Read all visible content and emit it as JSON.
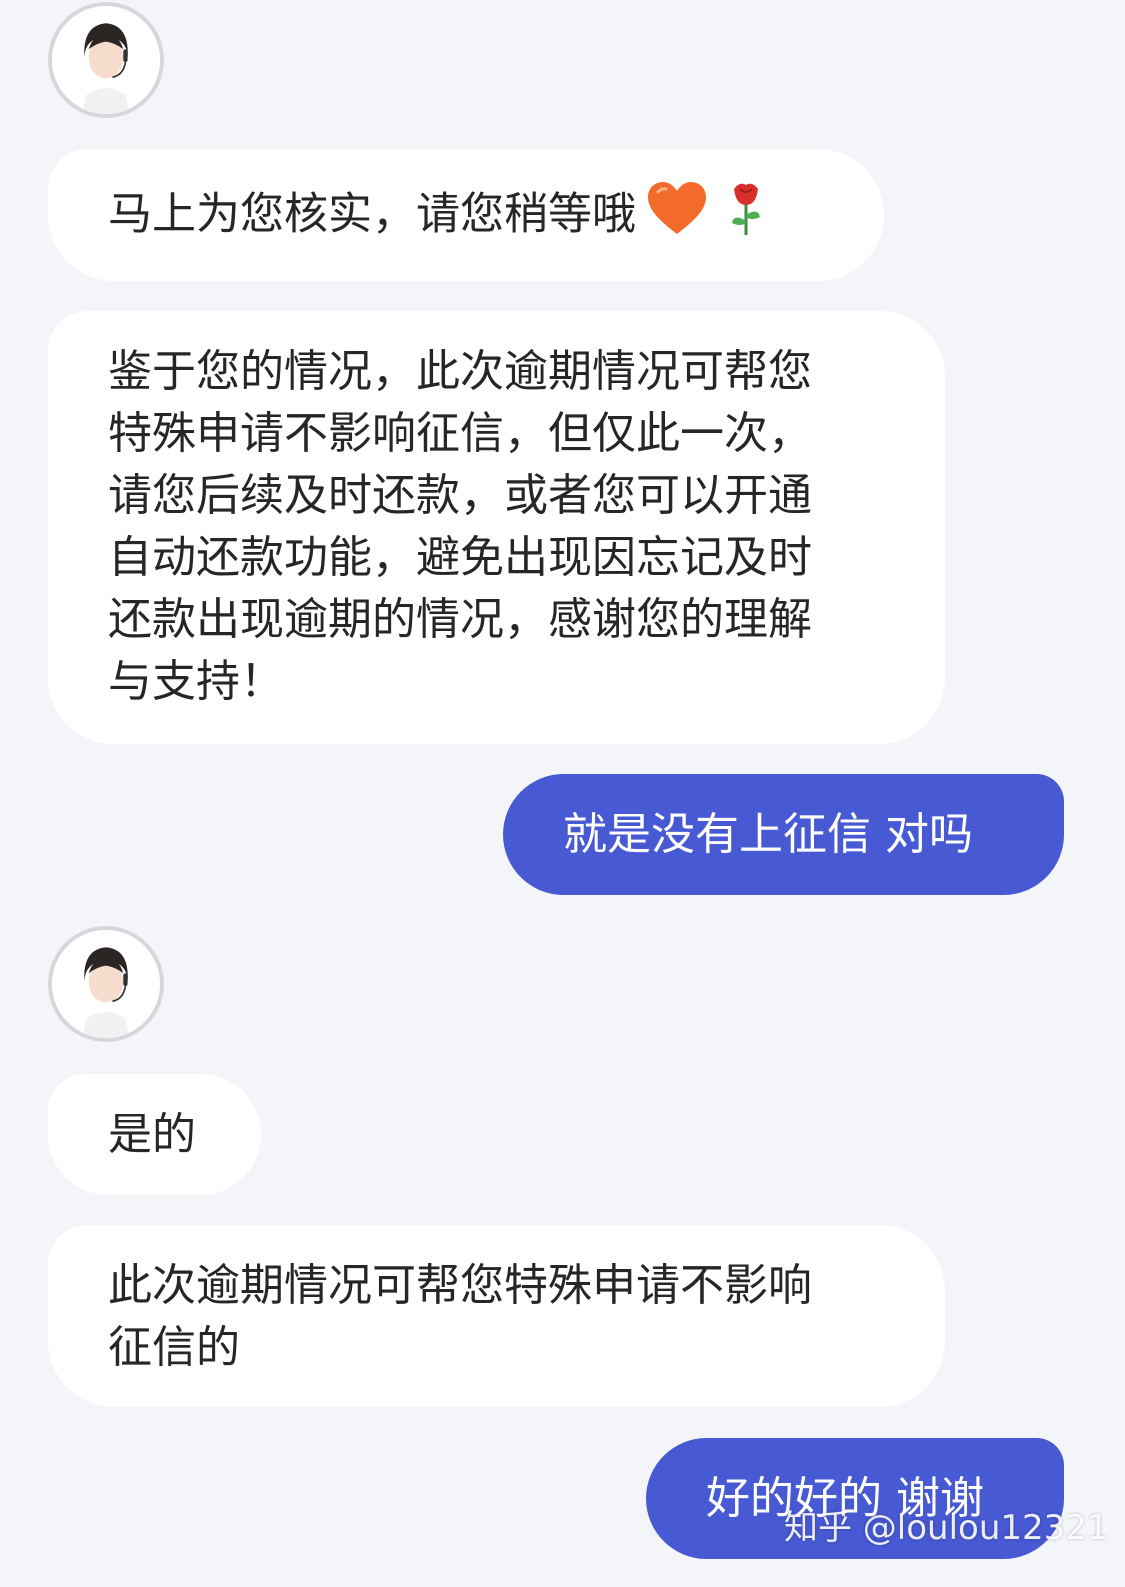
{
  "conversation": {
    "messages": [
      {
        "sender": "agent",
        "lines": [
          "马上为您核实，请您稍等哦"
        ],
        "emojis": [
          "orange-heart-icon",
          "rose-icon"
        ]
      },
      {
        "sender": "agent",
        "lines": [
          "鉴于您的情况，此次逾期情况可帮您",
          "特殊申请不影响征信，但仅此一次，",
          "请您后续及时还款，或者您可以开通",
          "自动还款功能，避免出现因忘记及时",
          "还款出现逾期的情况，感谢您的理解",
          "与支持！"
        ]
      },
      {
        "sender": "user",
        "lines": [
          "就是没有上征信 对吗"
        ]
      },
      {
        "sender": "agent",
        "lines": [
          "是的"
        ]
      },
      {
        "sender": "agent",
        "lines": [
          "此次逾期情况可帮您特殊申请不影响",
          "征信的"
        ]
      },
      {
        "sender": "user",
        "lines": [
          "好的好的 谢谢"
        ]
      }
    ]
  },
  "watermark": "知乎 @loulou12321",
  "colors": {
    "background": "#f4f5f9",
    "agent_bubble": "#ffffff",
    "user_bubble": "#4759d3",
    "agent_text": "#262626",
    "user_text": "#ffffff",
    "heart": "#f26b2a",
    "rose": "#d9302c"
  }
}
